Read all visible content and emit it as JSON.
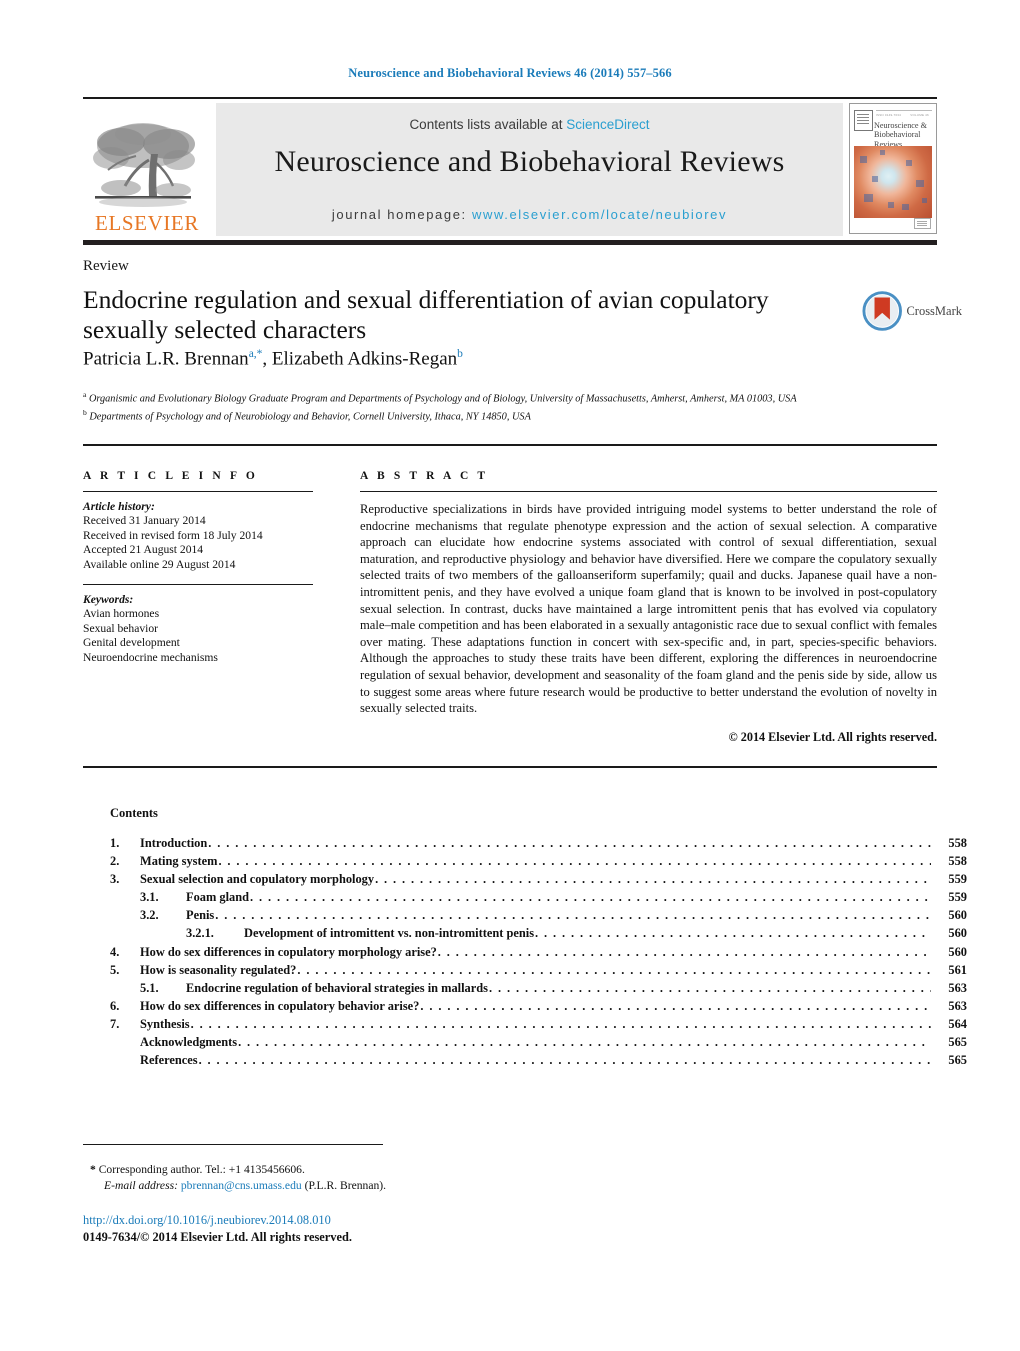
{
  "running_head": "Neuroscience and Biobehavioral Reviews 46 (2014) 557–566",
  "masthead": {
    "publisher_wordmark": "ELSEVIER",
    "contents_prefix": "Contents lists available at ",
    "contents_link": "ScienceDirect",
    "journal_title": "Neuroscience and Biobehavioral Reviews",
    "homepage_prefix": "journal homepage: ",
    "homepage_url": "www.elsevier.com/locate/neubiorev",
    "cover_title": "Neuroscience & Biobehavioral Reviews"
  },
  "article": {
    "doctype": "Review",
    "title": "Endocrine regulation and sexual differentiation of avian copulatory sexually selected characters",
    "crossmark_label": "CrossMark",
    "authors": "Patricia L.R. Brennan",
    "author_sup_a": "a,*",
    "author_two": ", Elizabeth Adkins-Regan",
    "author_sup_b": "b",
    "affiliation_a_marker": "a",
    "affiliation_a": "Organismic and Evolutionary Biology Graduate Program and Departments of Psychology and of Biology, University of Massachusetts, Amherst, Amherst, MA 01003, USA",
    "affiliation_b_marker": "b",
    "affiliation_b": "Departments of Psychology and of Neurobiology and Behavior, Cornell University, Ithaca, NY 14850, USA"
  },
  "info": {
    "heading": "A R T I C L E   I N F O",
    "history_label": "Article history:",
    "history": [
      "Received 31 January 2014",
      "Received in revised form 18 July 2014",
      "Accepted 21 August 2014",
      "Available online 29 August 2014"
    ],
    "keywords_label": "Keywords:",
    "keywords": [
      "Avian hormones",
      "Sexual behavior",
      "Genital development",
      "Neuroendocrine mechanisms"
    ]
  },
  "abstract": {
    "heading": "A B S T R A C T",
    "text": "Reproductive specializations in birds have provided intriguing model systems to better understand the role of endocrine mechanisms that regulate phenotype expression and the action of sexual selection. A comparative approach can elucidate how endocrine systems associated with control of sexual differentiation, sexual maturation, and reproductive physiology and behavior have diversified. Here we compare the copulatory sexually selected traits of two members of the galloanseriform superfamily; quail and ducks. Japanese quail have a non-intromittent penis, and they have evolved a unique foam gland that is known to be involved in post-copulatory sexual selection. In contrast, ducks have maintained a large intromittent penis that has evolved via copulatory male–male competition and has been elaborated in a sexually antagonistic race due to sexual conflict with females over mating. These adaptations function in concert with sex-specific and, in part, species-specific behaviors. Although the approaches to study these traits have been different, exploring the differences in neuroendocrine regulation of sexual behavior, development and seasonality of the foam gland and the penis side by side, allow us to suggest some areas where future research would be productive to better understand the evolution of novelty in sexually selected traits.",
    "copyright": "© 2014 Elsevier Ltd. All rights reserved."
  },
  "contents": {
    "heading": "Contents",
    "rows": [
      {
        "level": 1,
        "num": "1.",
        "label": "Introduction",
        "page": "558"
      },
      {
        "level": 1,
        "num": "2.",
        "label": "Mating system",
        "page": "558"
      },
      {
        "level": 1,
        "num": "3.",
        "label": "Sexual selection and copulatory morphology",
        "page": "559"
      },
      {
        "level": 2,
        "num": "3.1.",
        "label": "Foam gland",
        "page": "559"
      },
      {
        "level": 2,
        "num": "3.2.",
        "label": "Penis",
        "page": "560"
      },
      {
        "level": 3,
        "num": "3.2.1.",
        "label": "Development of intromittent vs. non-intromittent penis",
        "page": "560"
      },
      {
        "level": 1,
        "num": "4.",
        "label": "How do sex differences in copulatory morphology arise?",
        "page": "560"
      },
      {
        "level": 1,
        "num": "5.",
        "label": "How is seasonality regulated?",
        "page": "561"
      },
      {
        "level": 2,
        "num": "5.1.",
        "label": "Endocrine regulation of behavioral strategies in mallards",
        "page": "563"
      },
      {
        "level": 1,
        "num": "6.",
        "label": "How do sex differences in copulatory behavior arise?",
        "page": "563"
      },
      {
        "level": 1,
        "num": "7.",
        "label": "Synthesis",
        "page": "564"
      },
      {
        "level": 0,
        "num": "",
        "label": "Acknowledgments",
        "page": "565"
      },
      {
        "level": 0,
        "num": "",
        "label": "References",
        "page": "565"
      }
    ]
  },
  "footer": {
    "corresponding_marker": "*",
    "corresponding_text": "Corresponding author. Tel.: +1 4135456606.",
    "email_label": "E-mail address:",
    "email": "pbrennan@cns.umass.edu",
    "email_owner": "(P.L.R. Brennan).",
    "doi": "http://dx.doi.org/10.1016/j.neubiorev.2014.08.010",
    "issn_line": "0149-7634/© 2014 Elsevier Ltd. All rights reserved."
  },
  "colors": {
    "link_blue": "#1a7bb9",
    "sciencedirect_blue": "#2a9fd0",
    "elsevier_orange": "#e77725",
    "band_gray": "#e9e9e9",
    "rule_black": "#231f20"
  }
}
